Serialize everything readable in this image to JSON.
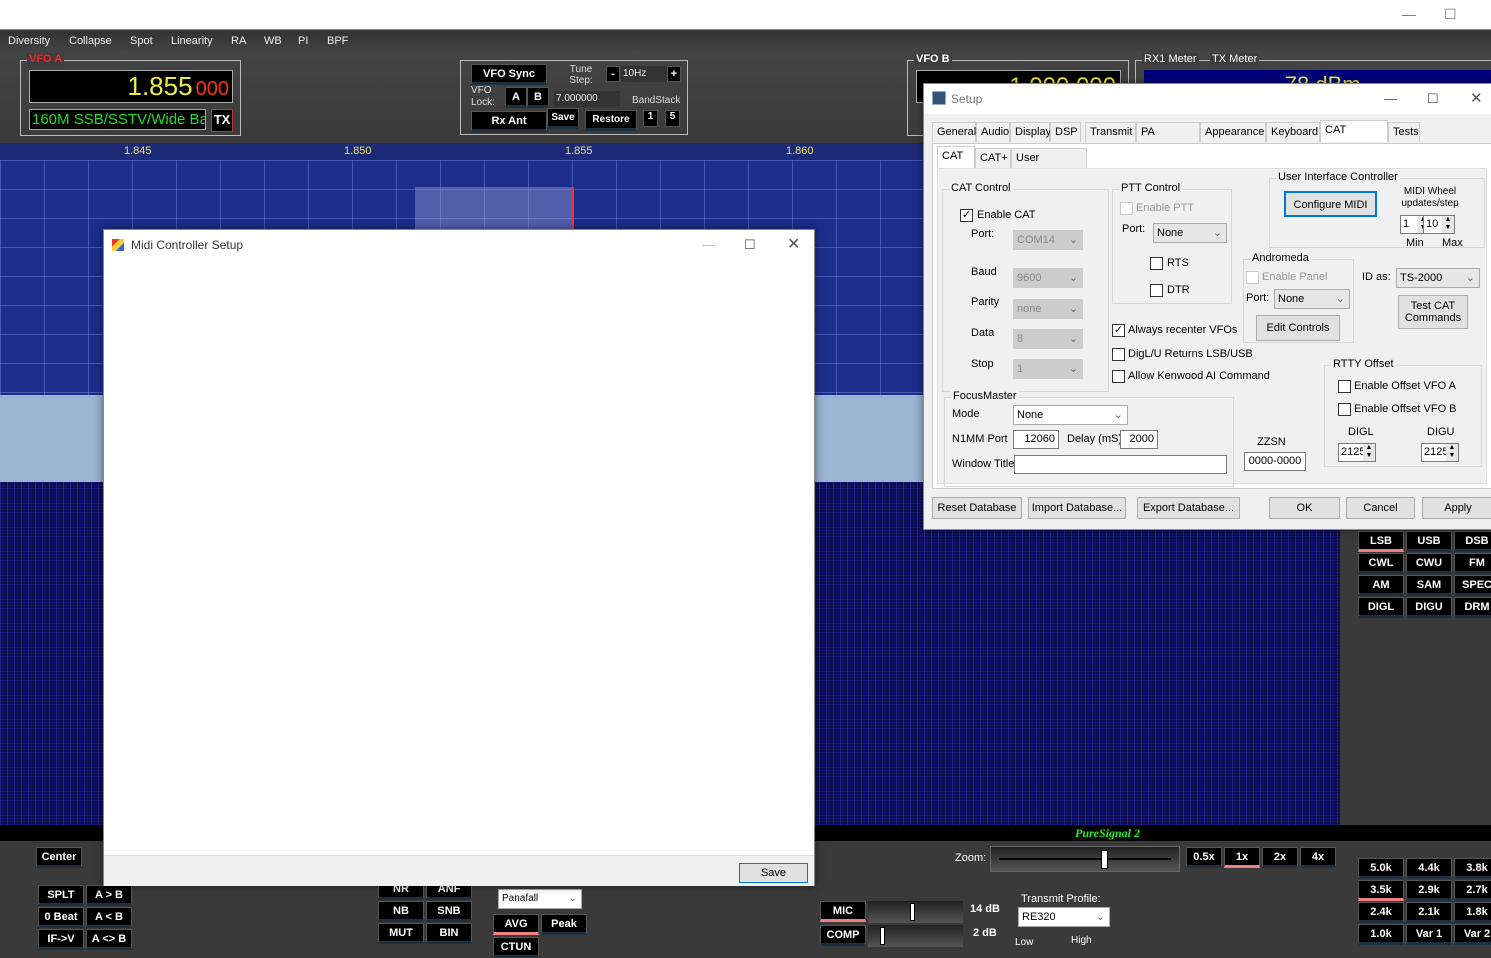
{
  "window": {
    "minimize": "—",
    "maximize": "☐"
  },
  "menu": [
    "Diversity",
    "Collapse",
    "Spot",
    "Linearity",
    "RA",
    "WB",
    "PI",
    "BPF"
  ],
  "vfo_a": {
    "title": "VFO A",
    "freq_main": "1.855",
    "freq_sub": "000",
    "band": "160M SSB/SSTV/Wide Ba",
    "tx": "TX"
  },
  "vfo_ctrl": {
    "sync": "VFO Sync",
    "tune_step_label": "Tune Step:",
    "tune_minus": "-",
    "tune_step": "10Hz",
    "tune_plus": "+",
    "lock_label": "VFO Lock:",
    "a": "A",
    "b": "B",
    "freq": "7.000000",
    "bandstack": "BandStack",
    "rx_ant": "Rx Ant",
    "save": "Save",
    "restore": "Restore",
    "bs1": "1",
    "bs2": "5"
  },
  "vfo_b": {
    "title": "VFO B",
    "freq": "1.000.000"
  },
  "meters": {
    "rx1": "RX1 Meter",
    "tx": "TX Meter",
    "reading": "-78 dBm"
  },
  "scale": [
    "1.845",
    "1.850",
    "1.855",
    "1.860"
  ],
  "puresignal": "PureSignal 2",
  "midi_dialog": {
    "title": "Midi Controller Setup",
    "save": "Save"
  },
  "setup": {
    "title": "Setup",
    "tabs": [
      "General",
      "Audio",
      "Display",
      "DSP",
      "Transmit",
      "PA Settings",
      "Appearance",
      "Keyboard",
      "CAT Control",
      "Tests"
    ],
    "active_tab": "CAT Control",
    "subtabs": [
      "CAT",
      "CAT+",
      "User Interface"
    ],
    "cat": {
      "group": "CAT Control",
      "enable": "Enable CAT",
      "port_label": "Port:",
      "port": "COM14",
      "baud_label": "Baud",
      "baud": "9600",
      "parity_label": "Parity",
      "parity": "none",
      "data_label": "Data",
      "data": "8",
      "stop_label": "Stop",
      "stop": "1"
    },
    "ptt": {
      "group": "PTT Control",
      "enable": "Enable PTT",
      "port_label": "Port:",
      "port": "None",
      "rts": "RTS",
      "dtr": "DTR"
    },
    "uic": {
      "group": "User Interface Controller",
      "configure": "Configure MIDI",
      "wheel": "MIDI  Wheel updates/step",
      "min": "1",
      "max": "10",
      "min_label": "Min",
      "max_label": "Max"
    },
    "andromeda": {
      "group": "Andromeda",
      "enable": "Enable Panel",
      "port_label": "Port:",
      "port": "None",
      "edit": "Edit Controls"
    },
    "id_label": "ID as:",
    "id": "TS-2000",
    "test_cat": "Test CAT Commands",
    "always_recenter": "Always recenter VFOs",
    "digl_returns": "DigL/U Returns LSB/USB",
    "allow_kenwood": "Allow Kenwood AI Command",
    "rtty": {
      "group": "RTTY Offset",
      "vfo_a": "Enable Offset VFO A",
      "vfo_b": "Enable Offset VFO B",
      "digl": "DIGL",
      "digu": "DIGU",
      "digl_val": "2125",
      "digu_val": "2125"
    },
    "focus": {
      "group": "FocusMaster",
      "mode_label": "Mode",
      "mode": "None",
      "n1mm_label": "N1MM Port",
      "n1mm": "12060",
      "delay_label": "Delay (mS)",
      "delay": "2000",
      "title_label": "Window Title",
      "title": ""
    },
    "zzsn_label": "ZZSN",
    "zzsn": "0000-0000",
    "buttons": {
      "reset": "Reset Database",
      "import": "Import Database...",
      "export": "Export Database...",
      "ok": "OK",
      "cancel": "Cancel",
      "apply": "Apply"
    }
  },
  "modes": [
    "LSB",
    "USB",
    "DSB",
    "CWL",
    "CWU",
    "FM",
    "AM",
    "SAM",
    "SPEC",
    "DIGL",
    "DIGU",
    "DRM"
  ],
  "filters": [
    "5.0k",
    "4.4k",
    "3.8k",
    "3.5k",
    "2.9k",
    "2.7k",
    "2.4k",
    "2.1k",
    "1.8k",
    "1.0k",
    "Var 1",
    "Var 2"
  ],
  "zoom": {
    "label": "Zoom:",
    "levels": [
      "0.5x",
      "1x",
      "2x",
      "4x"
    ]
  },
  "bottom": {
    "center": "Center",
    "vfo_btns": [
      "SPLT",
      "A > B",
      "0 Beat",
      "A < B",
      "IF->V",
      "A <> B"
    ],
    "dsp": [
      "NR",
      "ANF",
      "NB",
      "SNB",
      "MUT",
      "BIN"
    ],
    "display_mode": "Panafall",
    "avg": "AVG",
    "peak": "Peak",
    "ctun": "CTUN",
    "mic": "MIC",
    "mic_db": "14 dB",
    "comp": "COMP",
    "comp_db": "2 dB",
    "tx_profile_label": "Transmit Profile:",
    "tx_profile": "RE320",
    "low": "Low",
    "high": "High"
  }
}
